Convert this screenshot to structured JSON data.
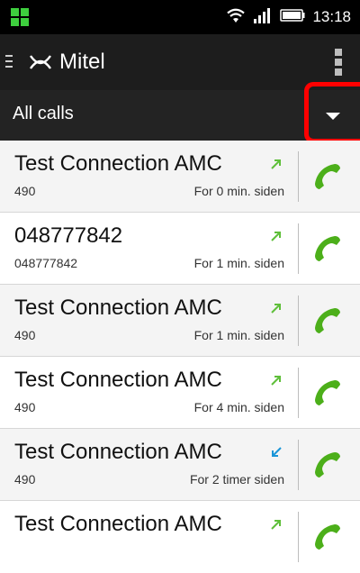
{
  "status": {
    "time": "13:18"
  },
  "header": {
    "brand": "Mitel"
  },
  "filter": {
    "label": "All calls"
  },
  "calls": [
    {
      "name": "Test Connection AMC",
      "number": "490",
      "time": "For 0 min. siden",
      "direction": "outgoing"
    },
    {
      "name": "048777842",
      "number": "048777842",
      "time": "For 1 min. siden",
      "direction": "outgoing"
    },
    {
      "name": "Test Connection AMC",
      "number": "490",
      "time": "For 1 min. siden",
      "direction": "outgoing"
    },
    {
      "name": "Test Connection AMC",
      "number": "490",
      "time": "For 4 min. siden",
      "direction": "outgoing"
    },
    {
      "name": "Test Connection AMC",
      "number": "490",
      "time": "For 2 timer siden",
      "direction": "incoming"
    },
    {
      "name": "Test Connection AMC",
      "number": "",
      "time": "",
      "direction": "outgoing"
    }
  ],
  "colors": {
    "outgoing_arrow": "#5fbf3a",
    "incoming_arrow": "#1a95d8",
    "call_icon": "#4caf1a",
    "highlight": "#ff0000"
  }
}
